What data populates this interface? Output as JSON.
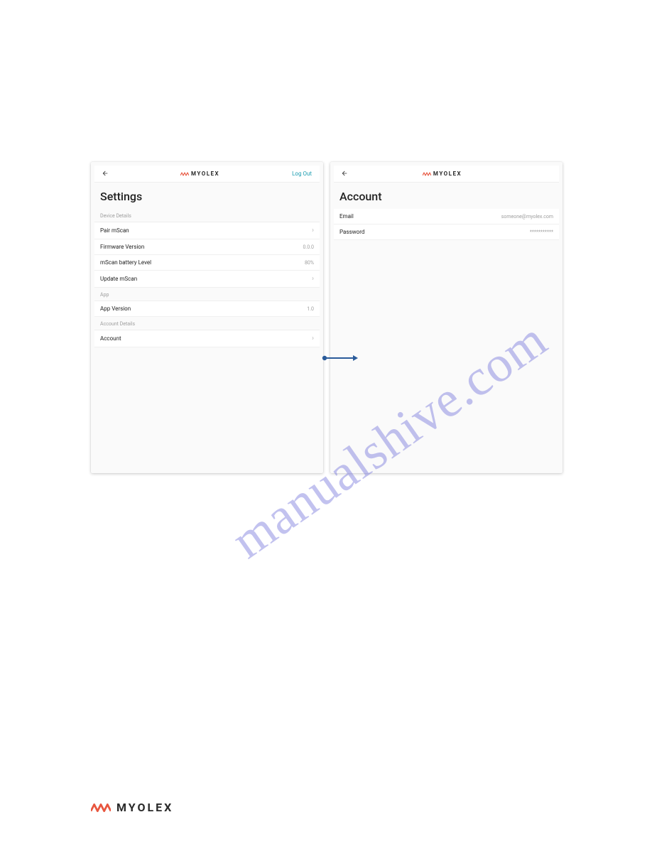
{
  "brand": {
    "name": "MYOLEX"
  },
  "watermark": "manualshive.com",
  "left_panel": {
    "logout": "Log Out",
    "title": "Settings",
    "sections": {
      "device": {
        "header": "Device Details",
        "pair_label": "Pair mScan",
        "firmware_label": "Firmware Version",
        "firmware_value": "0.0.0",
        "battery_label": "mScan battery Level",
        "battery_value": "80%",
        "update_label": "Update mScan"
      },
      "app": {
        "header": "App",
        "version_label": "App Version",
        "version_value": "1.0"
      },
      "account": {
        "header": "Account Details",
        "account_label": "Account"
      }
    }
  },
  "right_panel": {
    "title": "Account",
    "email_label": "Email",
    "email_value": "someone@myolex.com",
    "password_label": "Password",
    "password_value": "***********"
  }
}
